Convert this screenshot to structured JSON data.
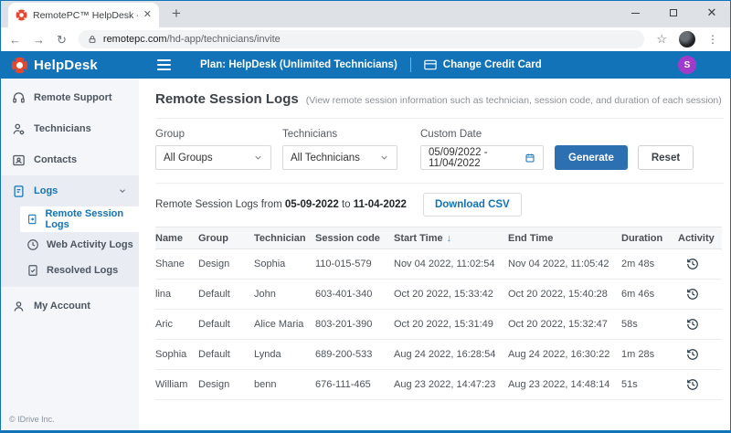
{
  "browser": {
    "tab_title": "RemotePC™ HelpDesk - Remote",
    "tab_close": "✕",
    "new_tab": "+",
    "back": "←",
    "forward": "→",
    "reload": "↻",
    "url_domain": "remotepc.com",
    "url_path": "/hd-app/technicians/invite",
    "star": "☆",
    "menu_dots": "⋮",
    "close_btn": "✕"
  },
  "header": {
    "brand": "HelpDesk",
    "plan": "Plan: HelpDesk (Unlimited Technicians)",
    "change_credit_card": "Change Credit Card",
    "avatar_initial": "S",
    "colors": {
      "header_blue": "#1273b9",
      "avatar_purple": "#a03cc9",
      "logo_red": "#e8452e"
    }
  },
  "sidebar": {
    "items": [
      {
        "label": "Remote Support"
      },
      {
        "label": "Technicians"
      },
      {
        "label": "Contacts"
      },
      {
        "label": "Logs"
      },
      {
        "label": "Remote Session Logs"
      },
      {
        "label": "Web Activity Logs"
      },
      {
        "label": "Resolved Logs"
      },
      {
        "label": "My Account"
      }
    ],
    "active_item": "Remote Session Logs",
    "footer": "© IDrive Inc."
  },
  "page": {
    "title": "Remote Session Logs",
    "subtitle": "(View remote session information such as technician, session code, and duration of each session)"
  },
  "filters": {
    "group_label": "Group",
    "group_value": "All Groups",
    "technicians_label": "Technicians",
    "technicians_value": "All Technicians",
    "date_label": "Custom Date",
    "date_value": "05/09/2022 - 11/04/2022",
    "generate": "Generate",
    "reset": "Reset"
  },
  "summary": {
    "prefix": "Remote Session Logs from",
    "from_date": "05-09-2022",
    "middle": "to",
    "to_date": "11-04-2022",
    "download_csv": "Download CSV"
  },
  "table": {
    "headers": [
      "Name",
      "Group",
      "Technician",
      "Session code",
      "Start Time",
      "End Time",
      "Duration",
      "Activity"
    ],
    "sort_arrow": "↓",
    "sorted_by": "Start Time",
    "rows": [
      {
        "name": "Shane",
        "group": "Design",
        "technician": "Sophia",
        "code": "110-015-579",
        "start": "Nov 04 2022, 11:02:54",
        "end": "Nov 04 2022, 11:05:42",
        "duration": "2m 48s"
      },
      {
        "name": "lina",
        "group": "Default",
        "technician": "John",
        "code": "603-401-340",
        "start": "Oct 20 2022, 15:33:42",
        "end": "Oct 20 2022, 15:40:28",
        "duration": "6m 46s"
      },
      {
        "name": "Aric",
        "group": "Default",
        "technician": "Alice Maria",
        "code": "803-201-390",
        "start": "Oct 20 2022, 15:31:49",
        "end": "Oct 20 2022, 15:32:47",
        "duration": "58s"
      },
      {
        "name": "Sophia",
        "group": "Default",
        "technician": "Lynda",
        "code": "689-200-533",
        "start": "Aug 24 2022, 16:28:54",
        "end": "Aug 24 2022, 16:30:22",
        "duration": "1m 28s"
      },
      {
        "name": "William",
        "group": "Design",
        "technician": "benn",
        "code": "676-111-465",
        "start": "Aug 23 2022, 14:47:23",
        "end": "Aug 23 2022, 14:48:14",
        "duration": "51s"
      }
    ]
  }
}
